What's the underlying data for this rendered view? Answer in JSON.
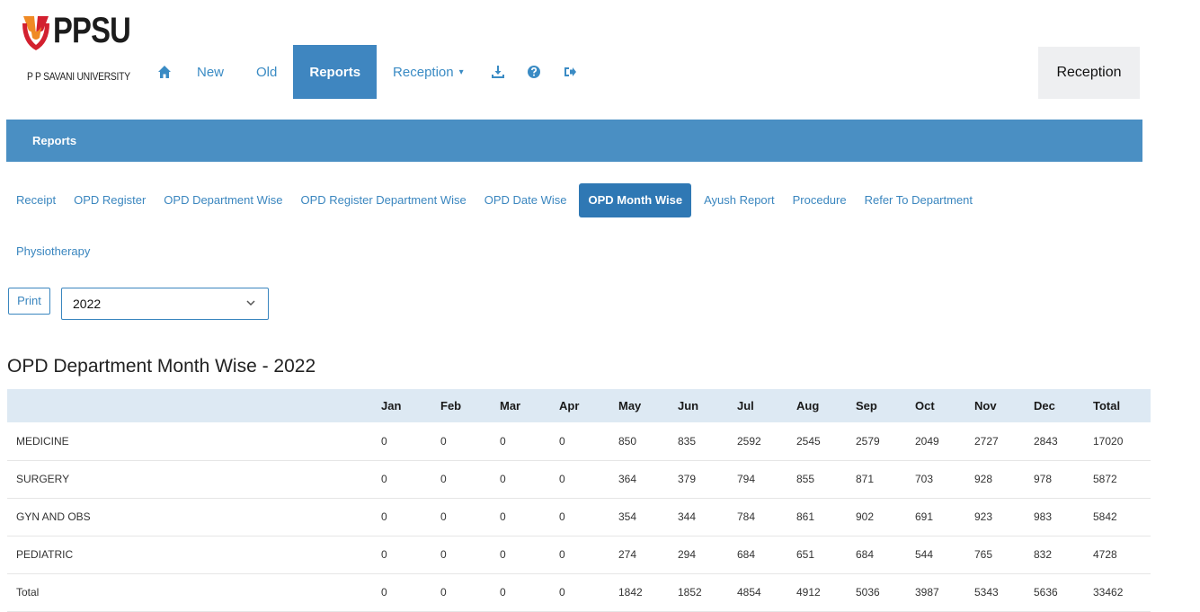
{
  "brand": {
    "name": "PPSU",
    "subtitle": "P P SAVANI UNIVERSITY",
    "colors": {
      "mark_red": "#d3202f",
      "mark_orange": "#f08a24"
    }
  },
  "nav": {
    "home_icon": "home-icon",
    "items": [
      {
        "label": "New"
      },
      {
        "label": "Old"
      },
      {
        "label": "Reports"
      },
      {
        "label": "Reception"
      }
    ],
    "icons": [
      "download-icon",
      "help-icon",
      "logout-icon"
    ],
    "user_label": "Reception"
  },
  "banner": {
    "title": "Reports"
  },
  "subtabs": [
    {
      "label": "Receipt"
    },
    {
      "label": "OPD Register"
    },
    {
      "label": "OPD Department Wise"
    },
    {
      "label": "OPD Register Department Wise"
    },
    {
      "label": "OPD Date Wise"
    },
    {
      "label": "OPD Month Wise"
    },
    {
      "label": "Ayush Report"
    },
    {
      "label": "Procedure"
    },
    {
      "label": "Refer To Department"
    },
    {
      "label": "Physiotherapy"
    }
  ],
  "controls": {
    "print_label": "Print",
    "year_value": "2022"
  },
  "report": {
    "title": "OPD Department Month Wise - 2022",
    "columns": [
      "",
      "Jan",
      "Feb",
      "Mar",
      "Apr",
      "May",
      "Jun",
      "Jul",
      "Aug",
      "Sep",
      "Oct",
      "Nov",
      "Dec",
      "Total"
    ],
    "rows": [
      [
        "MEDICINE",
        "0",
        "0",
        "0",
        "0",
        "850",
        "835",
        "2592",
        "2545",
        "2579",
        "2049",
        "2727",
        "2843",
        "17020"
      ],
      [
        "SURGERY",
        "0",
        "0",
        "0",
        "0",
        "364",
        "379",
        "794",
        "855",
        "871",
        "703",
        "928",
        "978",
        "5872"
      ],
      [
        "GYN AND OBS",
        "0",
        "0",
        "0",
        "0",
        "354",
        "344",
        "784",
        "861",
        "902",
        "691",
        "923",
        "983",
        "5842"
      ],
      [
        "PEDIATRIC",
        "0",
        "0",
        "0",
        "0",
        "274",
        "294",
        "684",
        "651",
        "684",
        "544",
        "765",
        "832",
        "4728"
      ],
      [
        "Total",
        "0",
        "0",
        "0",
        "0",
        "1842",
        "1852",
        "4854",
        "4912",
        "5036",
        "3987",
        "5343",
        "5636",
        "33462"
      ]
    ]
  },
  "colors": {
    "accent": "#3f86c0",
    "link": "#3a86bf",
    "header_row": "#dde9f3"
  }
}
